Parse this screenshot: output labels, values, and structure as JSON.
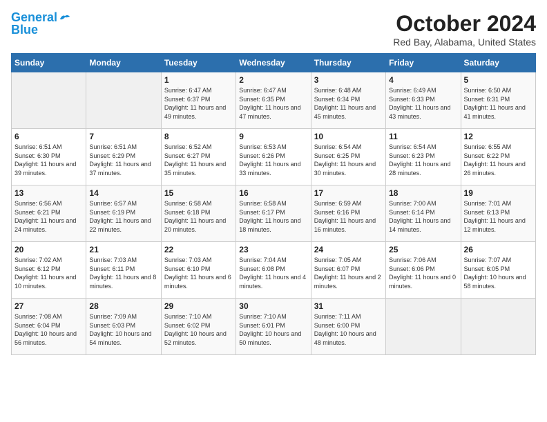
{
  "logo": {
    "line1": "General",
    "line2": "Blue"
  },
  "title": "October 2024",
  "location": "Red Bay, Alabama, United States",
  "days_of_week": [
    "Sunday",
    "Monday",
    "Tuesday",
    "Wednesday",
    "Thursday",
    "Friday",
    "Saturday"
  ],
  "weeks": [
    [
      {
        "day": "",
        "empty": true
      },
      {
        "day": "",
        "empty": true
      },
      {
        "day": "1",
        "sunrise": "6:47 AM",
        "sunset": "6:37 PM",
        "daylight": "11 hours and 49 minutes."
      },
      {
        "day": "2",
        "sunrise": "6:47 AM",
        "sunset": "6:35 PM",
        "daylight": "11 hours and 47 minutes."
      },
      {
        "day": "3",
        "sunrise": "6:48 AM",
        "sunset": "6:34 PM",
        "daylight": "11 hours and 45 minutes."
      },
      {
        "day": "4",
        "sunrise": "6:49 AM",
        "sunset": "6:33 PM",
        "daylight": "11 hours and 43 minutes."
      },
      {
        "day": "5",
        "sunrise": "6:50 AM",
        "sunset": "6:31 PM",
        "daylight": "11 hours and 41 minutes."
      }
    ],
    [
      {
        "day": "6",
        "sunrise": "6:51 AM",
        "sunset": "6:30 PM",
        "daylight": "11 hours and 39 minutes."
      },
      {
        "day": "7",
        "sunrise": "6:51 AM",
        "sunset": "6:29 PM",
        "daylight": "11 hours and 37 minutes."
      },
      {
        "day": "8",
        "sunrise": "6:52 AM",
        "sunset": "6:27 PM",
        "daylight": "11 hours and 35 minutes."
      },
      {
        "day": "9",
        "sunrise": "6:53 AM",
        "sunset": "6:26 PM",
        "daylight": "11 hours and 33 minutes."
      },
      {
        "day": "10",
        "sunrise": "6:54 AM",
        "sunset": "6:25 PM",
        "daylight": "11 hours and 30 minutes."
      },
      {
        "day": "11",
        "sunrise": "6:54 AM",
        "sunset": "6:23 PM",
        "daylight": "11 hours and 28 minutes."
      },
      {
        "day": "12",
        "sunrise": "6:55 AM",
        "sunset": "6:22 PM",
        "daylight": "11 hours and 26 minutes."
      }
    ],
    [
      {
        "day": "13",
        "sunrise": "6:56 AM",
        "sunset": "6:21 PM",
        "daylight": "11 hours and 24 minutes."
      },
      {
        "day": "14",
        "sunrise": "6:57 AM",
        "sunset": "6:19 PM",
        "daylight": "11 hours and 22 minutes."
      },
      {
        "day": "15",
        "sunrise": "6:58 AM",
        "sunset": "6:18 PM",
        "daylight": "11 hours and 20 minutes."
      },
      {
        "day": "16",
        "sunrise": "6:58 AM",
        "sunset": "6:17 PM",
        "daylight": "11 hours and 18 minutes."
      },
      {
        "day": "17",
        "sunrise": "6:59 AM",
        "sunset": "6:16 PM",
        "daylight": "11 hours and 16 minutes."
      },
      {
        "day": "18",
        "sunrise": "7:00 AM",
        "sunset": "6:14 PM",
        "daylight": "11 hours and 14 minutes."
      },
      {
        "day": "19",
        "sunrise": "7:01 AM",
        "sunset": "6:13 PM",
        "daylight": "11 hours and 12 minutes."
      }
    ],
    [
      {
        "day": "20",
        "sunrise": "7:02 AM",
        "sunset": "6:12 PM",
        "daylight": "11 hours and 10 minutes."
      },
      {
        "day": "21",
        "sunrise": "7:03 AM",
        "sunset": "6:11 PM",
        "daylight": "11 hours and 8 minutes."
      },
      {
        "day": "22",
        "sunrise": "7:03 AM",
        "sunset": "6:10 PM",
        "daylight": "11 hours and 6 minutes."
      },
      {
        "day": "23",
        "sunrise": "7:04 AM",
        "sunset": "6:08 PM",
        "daylight": "11 hours and 4 minutes."
      },
      {
        "day": "24",
        "sunrise": "7:05 AM",
        "sunset": "6:07 PM",
        "daylight": "11 hours and 2 minutes."
      },
      {
        "day": "25",
        "sunrise": "7:06 AM",
        "sunset": "6:06 PM",
        "daylight": "11 hours and 0 minutes."
      },
      {
        "day": "26",
        "sunrise": "7:07 AM",
        "sunset": "6:05 PM",
        "daylight": "10 hours and 58 minutes."
      }
    ],
    [
      {
        "day": "27",
        "sunrise": "7:08 AM",
        "sunset": "6:04 PM",
        "daylight": "10 hours and 56 minutes."
      },
      {
        "day": "28",
        "sunrise": "7:09 AM",
        "sunset": "6:03 PM",
        "daylight": "10 hours and 54 minutes."
      },
      {
        "day": "29",
        "sunrise": "7:10 AM",
        "sunset": "6:02 PM",
        "daylight": "10 hours and 52 minutes."
      },
      {
        "day": "30",
        "sunrise": "7:10 AM",
        "sunset": "6:01 PM",
        "daylight": "10 hours and 50 minutes."
      },
      {
        "day": "31",
        "sunrise": "7:11 AM",
        "sunset": "6:00 PM",
        "daylight": "10 hours and 48 minutes."
      },
      {
        "day": "",
        "empty": true
      },
      {
        "day": "",
        "empty": true
      }
    ]
  ]
}
